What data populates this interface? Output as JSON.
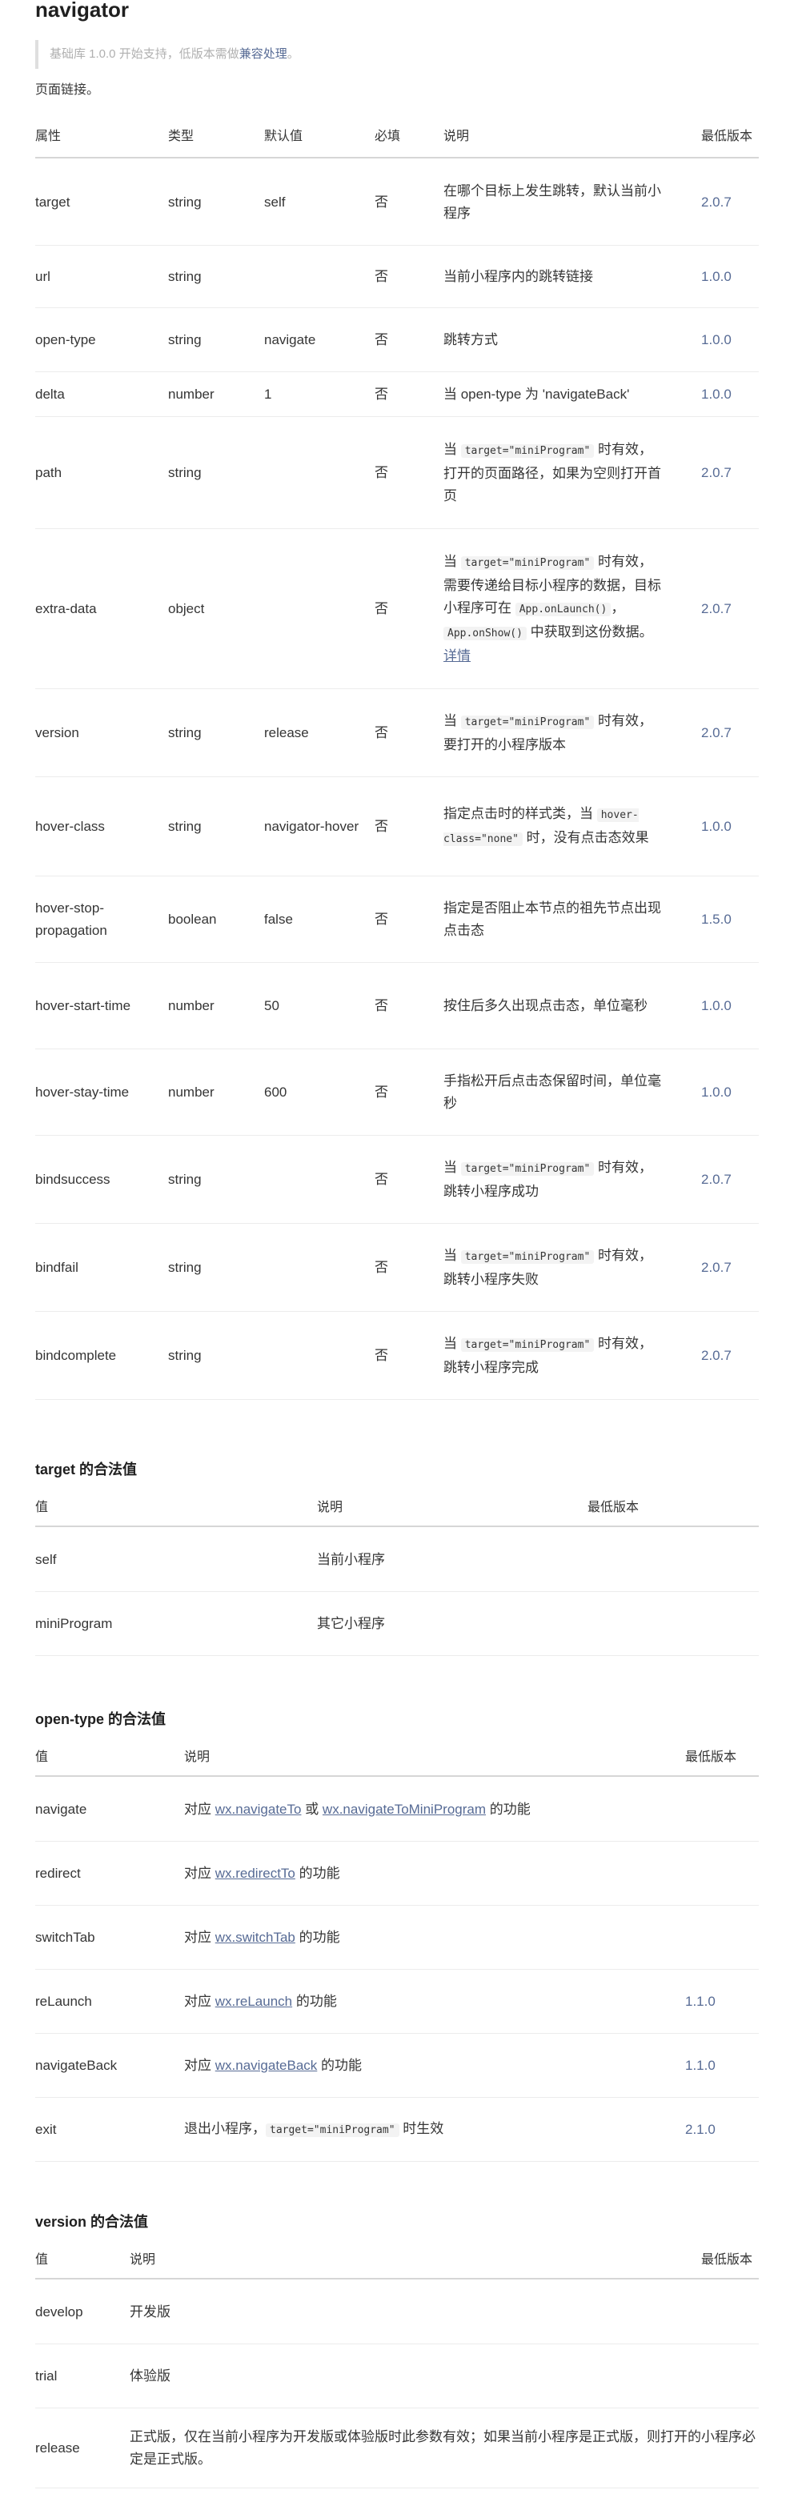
{
  "title": "navigator",
  "note": {
    "prefix": "基础库 1.0.0 开始支持，低版本需做",
    "link": "兼容处理",
    "suffix": "。"
  },
  "intro": "页面链接。",
  "props_table": {
    "headers": [
      "属性",
      "类型",
      "默认值",
      "必填",
      "说明",
      "最低版本"
    ],
    "rows": [
      {
        "name": "target",
        "type": "string",
        "default": "self",
        "required": "否",
        "desc": [
          {
            "t": "在哪个目标上发生跳转，默认当前小程序"
          }
        ],
        "version": "2.0.7"
      },
      {
        "name": "url",
        "type": "string",
        "default": "",
        "required": "否",
        "desc": [
          {
            "t": "当前小程序内的跳转链接"
          }
        ],
        "version": "1.0.0"
      },
      {
        "name": "open-type",
        "type": "string",
        "default": "navigate",
        "required": "否",
        "desc": [
          {
            "t": "跳转方式"
          }
        ],
        "version": "1.0.0"
      },
      {
        "name": "delta",
        "type": "number",
        "default": "1",
        "required": "否",
        "desc": [
          {
            "t": "当 open-type 为 'navigateBack'"
          }
        ],
        "version": "1.0.0"
      },
      {
        "name": "path",
        "type": "string",
        "default": "",
        "required": "否",
        "desc": [
          {
            "t": "当 "
          },
          {
            "c": "target=\"miniProgram\""
          },
          {
            "t": " 时有效，打开的页面路径，如果为空则打开首页"
          }
        ],
        "version": "2.0.7"
      },
      {
        "name": "extra-data",
        "type": "object",
        "default": "",
        "required": "否",
        "desc": [
          {
            "t": "当 "
          },
          {
            "c": "target=\"miniProgram\""
          },
          {
            "t": " 时有效，需要传递给目标小程序的数据，目标小程序可在 "
          },
          {
            "c": "App.onLaunch()"
          },
          {
            "t": "，"
          },
          {
            "c": "App.onShow()"
          },
          {
            "t": " 中获取到这份数据。"
          },
          {
            "l": "详情"
          }
        ],
        "version": "2.0.7"
      },
      {
        "name": "version",
        "type": "string",
        "default": "release",
        "required": "否",
        "desc": [
          {
            "t": "当 "
          },
          {
            "c": "target=\"miniProgram\""
          },
          {
            "t": " 时有效，要打开的小程序版本"
          }
        ],
        "version": "2.0.7"
      },
      {
        "name": "hover-class",
        "type": "string",
        "default": "navigator-hover",
        "required": "否",
        "desc": [
          {
            "t": "指定点击时的样式类，当 "
          },
          {
            "c": "hover-class=\"none\""
          },
          {
            "t": " 时，没有点击态效果"
          }
        ],
        "version": "1.0.0"
      },
      {
        "name": "hover-stop-propagation",
        "type": "boolean",
        "default": "false",
        "required": "否",
        "desc": [
          {
            "t": "指定是否阻止本节点的祖先节点出现点击态"
          }
        ],
        "version": "1.5.0"
      },
      {
        "name": "hover-start-time",
        "type": "number",
        "default": "50",
        "required": "否",
        "desc": [
          {
            "t": "按住后多久出现点击态，单位毫秒"
          }
        ],
        "version": "1.0.0"
      },
      {
        "name": "hover-stay-time",
        "type": "number",
        "default": "600",
        "required": "否",
        "desc": [
          {
            "t": "手指松开后点击态保留时间，单位毫秒"
          }
        ],
        "version": "1.0.0"
      },
      {
        "name": "bindsuccess",
        "type": "string",
        "default": "",
        "required": "否",
        "desc": [
          {
            "t": "当 "
          },
          {
            "c": "target=\"miniProgram\""
          },
          {
            "t": " 时有效，跳转小程序成功"
          }
        ],
        "version": "2.0.7"
      },
      {
        "name": "bindfail",
        "type": "string",
        "default": "",
        "required": "否",
        "desc": [
          {
            "t": "当 "
          },
          {
            "c": "target=\"miniProgram\""
          },
          {
            "t": " 时有效，跳转小程序失败"
          }
        ],
        "version": "2.0.7"
      },
      {
        "name": "bindcomplete",
        "type": "string",
        "default": "",
        "required": "否",
        "desc": [
          {
            "t": "当 "
          },
          {
            "c": "target=\"miniProgram\""
          },
          {
            "t": " 时有效，跳转小程序完成"
          }
        ],
        "version": "2.0.7"
      }
    ]
  },
  "target_section": {
    "heading": "target 的合法值",
    "headers": [
      "值",
      "说明",
      "最低版本"
    ],
    "rows": [
      {
        "value": "self",
        "desc": [
          {
            "t": "当前小程序"
          }
        ],
        "version": ""
      },
      {
        "value": "miniProgram",
        "desc": [
          {
            "t": "其它小程序"
          }
        ],
        "version": ""
      }
    ]
  },
  "opentype_section": {
    "heading": "open-type 的合法值",
    "headers": [
      "值",
      "说明",
      "最低版本"
    ],
    "rows": [
      {
        "value": "navigate",
        "desc": [
          {
            "t": "对应 "
          },
          {
            "l": "wx.navigateTo"
          },
          {
            "t": " 或 "
          },
          {
            "l": "wx.navigateToMiniProgram"
          },
          {
            "t": " 的功能"
          }
        ],
        "version": ""
      },
      {
        "value": "redirect",
        "desc": [
          {
            "t": "对应 "
          },
          {
            "l": "wx.redirectTo"
          },
          {
            "t": " 的功能"
          }
        ],
        "version": ""
      },
      {
        "value": "switchTab",
        "desc": [
          {
            "t": "对应 "
          },
          {
            "l": "wx.switchTab"
          },
          {
            "t": " 的功能"
          }
        ],
        "version": ""
      },
      {
        "value": "reLaunch",
        "desc": [
          {
            "t": "对应 "
          },
          {
            "l": "wx.reLaunch"
          },
          {
            "t": " 的功能"
          }
        ],
        "version": "1.1.0"
      },
      {
        "value": "navigateBack",
        "desc": [
          {
            "t": "对应 "
          },
          {
            "l": "wx.navigateBack"
          },
          {
            "t": " 的功能"
          }
        ],
        "version": "1.1.0"
      },
      {
        "value": "exit",
        "desc": [
          {
            "t": "退出小程序，"
          },
          {
            "c": "target=\"miniProgram\""
          },
          {
            "t": " 时生效"
          }
        ],
        "version": "2.1.0"
      }
    ]
  },
  "version_section": {
    "heading": "version 的合法值",
    "headers": [
      "值",
      "说明",
      "最低版本"
    ],
    "rows": [
      {
        "value": "develop",
        "desc": [
          {
            "t": "开发版"
          }
        ],
        "version": ""
      },
      {
        "value": "trial",
        "desc": [
          {
            "t": "体验版"
          }
        ],
        "version": ""
      },
      {
        "value": "release",
        "desc": [
          {
            "t": "正式版，仅在当前小程序为开发版或体验版时此参数有效；如果当前小程序是正式版，则打开的小程序必定是正式版。"
          }
        ],
        "version": ""
      }
    ]
  }
}
